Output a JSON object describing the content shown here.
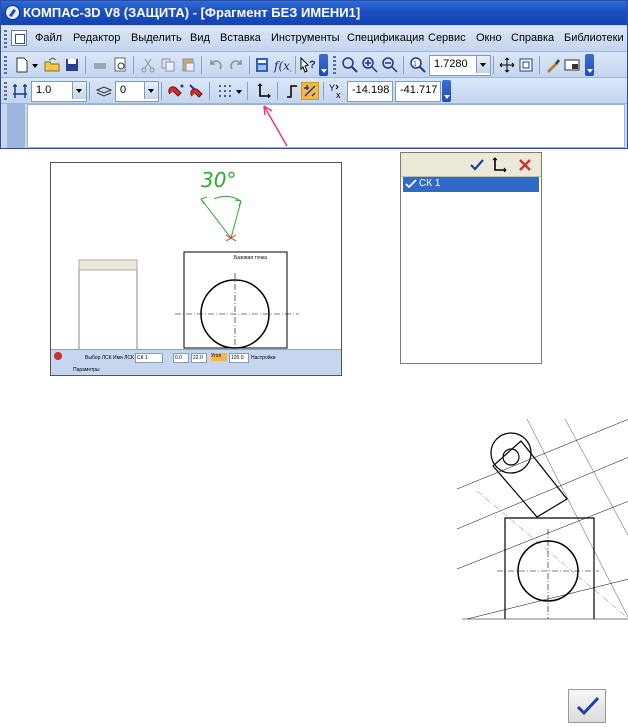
{
  "window": {
    "title": "КОМПАС-3D V8 (ЗАЩИТА) - [Фрагмент БЕЗ ИМЕНИ1]"
  },
  "menu": {
    "items": [
      "Файл",
      "Редактор",
      "Выделить",
      "Вид",
      "Вставка",
      "Инструменты",
      "Спецификация",
      "Сервис",
      "Окно",
      "Справка",
      "Библиотеки"
    ]
  },
  "toolbar1": {
    "zoom_value": "1.7280"
  },
  "toolbar2": {
    "step_value": "1.0",
    "layer_value": "0",
    "coord_label": "Y",
    "coord_x": "-14.198",
    "coord_y": "-41.717"
  },
  "colors": {
    "titlebar": "#1b4fc3",
    "toolbar": "#c5d6ee",
    "arrow": "#e8358a",
    "angle": "#2ea832",
    "selection": "#3169c6",
    "check": "#1f3fa8",
    "delete": "#d03030"
  },
  "thumbnail": {
    "angle_label": "30°",
    "point_label": "Базовая точка",
    "status": {
      "name_label": "Имя ЛСК",
      "name_value": "СК 1",
      "x_value": "0.0",
      "y_value": "22.0",
      "angle_label": "Угол",
      "angle_value": "120.0",
      "settings_label": "Настройки",
      "tab_label": "Параметры"
    }
  },
  "cs_panel": {
    "items": [
      {
        "label": "СК 1",
        "checked": true,
        "selected": true
      }
    ]
  },
  "icons": {
    "check": "check-icon",
    "new_cs": "new-coordinate-system-icon",
    "delete": "delete-icon"
  }
}
